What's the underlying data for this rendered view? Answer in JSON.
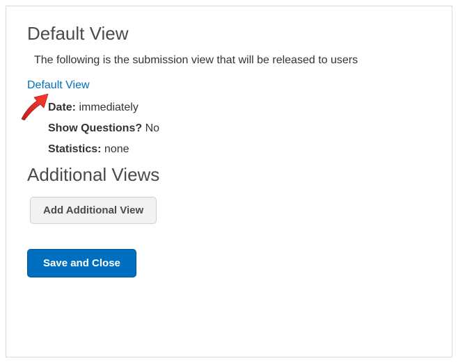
{
  "defaultView": {
    "heading": "Default View",
    "description": "The following is the submission view that will be released to users",
    "link": "Default View",
    "dateLabel": "Date:",
    "dateValue": " immediately",
    "showQuestionsLabel": "Show Questions?",
    "showQuestionsValue": " No",
    "statisticsLabel": "Statistics:",
    "statisticsValue": " none"
  },
  "additionalViews": {
    "heading": "Additional Views",
    "addButton": "Add Additional View"
  },
  "actions": {
    "saveAndClose": "Save and Close"
  }
}
